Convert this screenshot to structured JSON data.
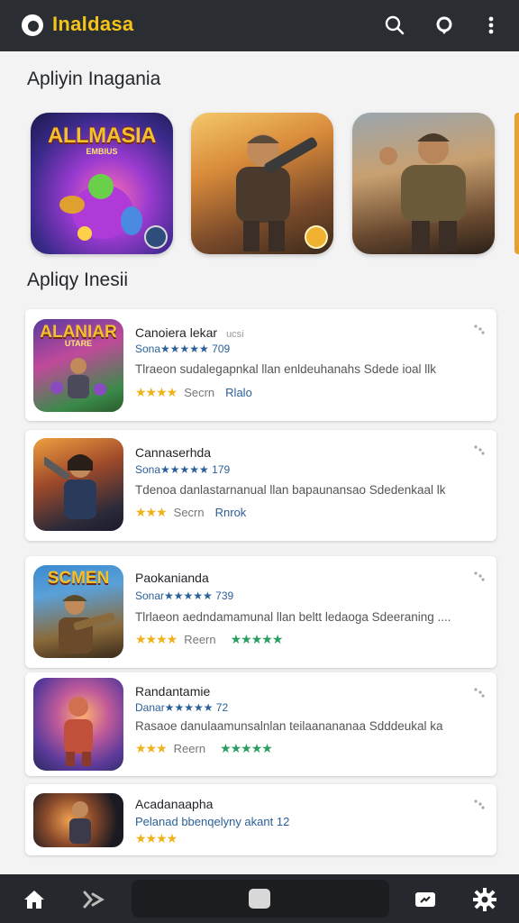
{
  "header": {
    "app_title": "Inaldasa",
    "icons": [
      "app-logo-icon",
      "search-icon",
      "location-pin-icon",
      "more-vert-icon"
    ]
  },
  "sections": {
    "featured_title": "Apliyin Inagania",
    "list_title": "Apliqy Inesii"
  },
  "featured": [
    {
      "art_title": "ALLMASIA",
      "art_sub": "EMBIUS",
      "has_badge": true,
      "colors": [
        "#5a2a9a",
        "#e0408a",
        "#3aa0e0"
      ]
    },
    {
      "art_title": "",
      "art_sub": "",
      "has_badge": true,
      "colors": [
        "#d07a2a",
        "#f0b040",
        "#3a2a1a"
      ]
    },
    {
      "art_title": "",
      "art_sub": "",
      "has_badge": false,
      "colors": [
        "#6a7078",
        "#c09050",
        "#3a2a20"
      ]
    }
  ],
  "apps": [
    {
      "art_title": "ALANIAR",
      "art_sub": "UTARE",
      "name": "Canoiera lekar",
      "name_extra": "ucsi",
      "rating": "Sona★★★★★ 709",
      "desc": "Tlraeon sudalegapnkal llan enldeuhanahs Sdede ioal llk",
      "meta_stars": "★★★★",
      "meta_label": "Secrn",
      "meta_tag": "Rlalo",
      "meta_green": ""
    },
    {
      "art_title": "",
      "art_sub": "",
      "name": "Cannaserhda",
      "name_extra": "",
      "rating": "Sona★★★★★ 179",
      "desc": "Tdenoa danlastarnanual llan bapaunansao Sdedenkaal lk",
      "meta_stars": "★★★",
      "meta_label": "Secrn",
      "meta_tag": "Rnrok",
      "meta_green": ""
    },
    {
      "art_title": "SCMEN",
      "art_sub": "",
      "name": "Paokanianda",
      "name_extra": "",
      "rating": "Sonar★★★★★ 739",
      "desc": "Tlrlaeon aedndamamunal llan beltt ledaoga Sdeeraning ....",
      "meta_stars": "★★★★",
      "meta_label": "Reern",
      "meta_tag": "",
      "meta_green": "★★★★★"
    },
    {
      "art_title": "",
      "art_sub": "",
      "name": "Randantamie",
      "name_extra": "",
      "rating": "Danar★★★★★ 72",
      "desc": "Rasaoe danulaamunsalnlan teilaanananaa Sdddeukal ka",
      "meta_stars": "★★★",
      "meta_label": "Reern",
      "meta_tag": "",
      "meta_green": "★★★★★"
    },
    {
      "art_title": "",
      "art_sub": "",
      "name": "Acadanaapha",
      "name_extra": "",
      "rating": "Pelanad bbenqelyny akant 12",
      "desc": "",
      "meta_stars": "★★★★",
      "meta_label": "",
      "meta_tag": "",
      "meta_green": ""
    }
  ],
  "bottom_nav": {
    "icons": [
      "home-icon",
      "share-icon",
      "square-home-button",
      "ticket-icon",
      "settings-icon"
    ]
  }
}
